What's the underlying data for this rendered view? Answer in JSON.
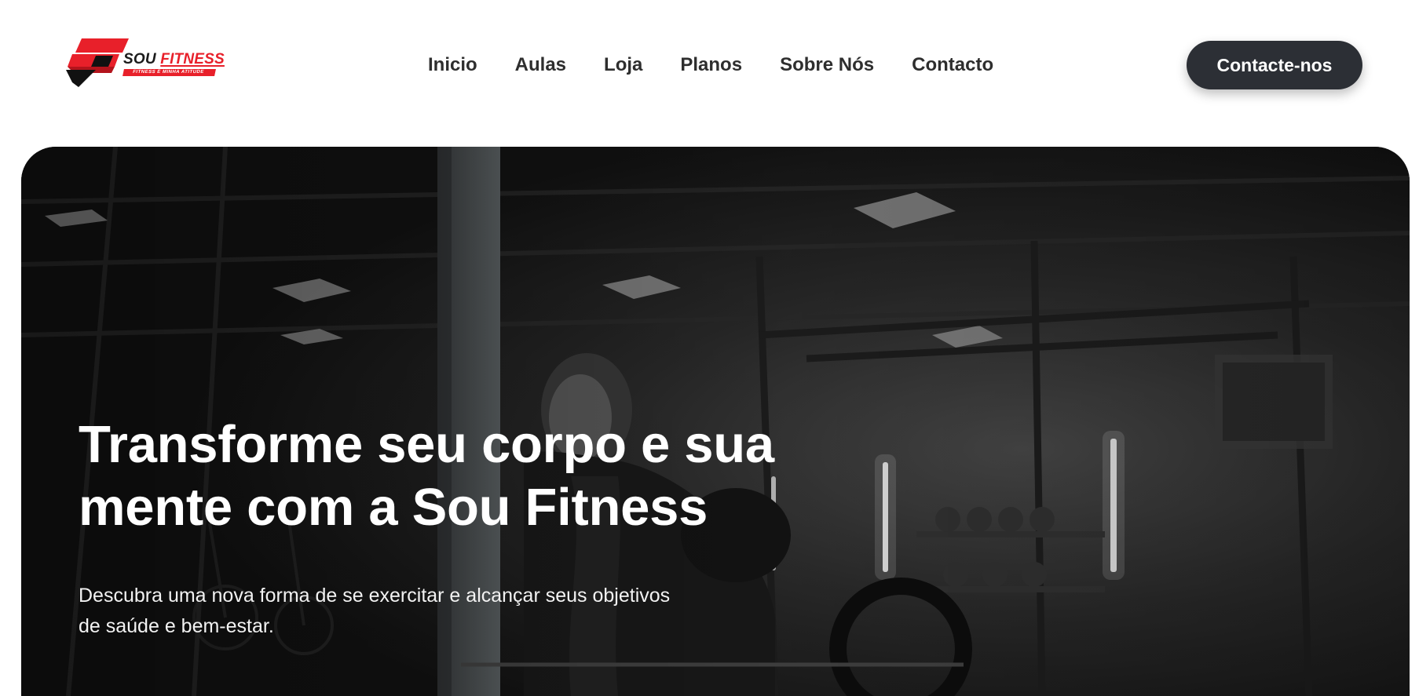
{
  "header": {
    "logo": {
      "brand_primary": "SOU ",
      "brand_accent": "FITNESS",
      "tagline": "FITNESS É MINHA ATITUDE",
      "colors": {
        "red": "#e8202a",
        "dark": "#1b1b1b"
      }
    },
    "nav": {
      "items": [
        {
          "label": "Inicio"
        },
        {
          "label": "Aulas"
        },
        {
          "label": "Loja"
        },
        {
          "label": "Planos"
        },
        {
          "label": "Sobre Nós"
        },
        {
          "label": "Contacto"
        }
      ]
    },
    "cta": {
      "label": "Contacte-nos",
      "color": "#2c2f35"
    }
  },
  "hero": {
    "title": "Transforme seu corpo e sua mente com a Sou Fitness",
    "subtitle": "Descubra uma nova forma de se exercitar e alcançar seus objetivos de saúde e bem-estar."
  }
}
